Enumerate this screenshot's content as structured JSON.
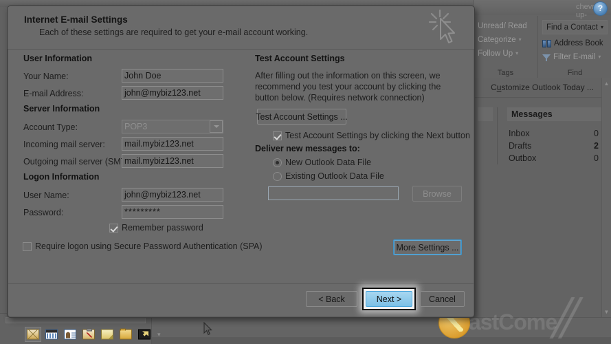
{
  "background": {
    "ribbon": {
      "help_icon": "?",
      "collapse_icon": "chevron-up-icon",
      "groups": [
        {
          "name": "Tags",
          "label": "Tags",
          "commands": [
            {
              "label": "Unread/ Read",
              "caret": ""
            },
            {
              "label": "Categorize",
              "caret": "▾"
            },
            {
              "label": "Follow Up",
              "caret": "▾"
            }
          ]
        },
        {
          "name": "Find",
          "label": "Find",
          "find_box": {
            "label": "Find a Contact",
            "caret": "▾"
          },
          "commands": [
            {
              "label": "Address Book",
              "caret": ""
            },
            {
              "label": "Filter E-mail",
              "caret": "▾"
            }
          ]
        }
      ]
    },
    "today_pane": {
      "customize_prefix": "C",
      "customize_underlined": "u",
      "customize_suffix": "stomize Outlook Today ...",
      "messages_title": "Messages",
      "messages": [
        {
          "label": "Inbox",
          "value": "0",
          "bold": false
        },
        {
          "label": "Drafts",
          "value": "2",
          "bold": true
        },
        {
          "label": "Outbox",
          "value": "0",
          "bold": false
        }
      ]
    },
    "nav_pane": {
      "icons": [
        {
          "name": "mail-icon",
          "selected": true
        },
        {
          "name": "calendar-icon",
          "selected": false
        },
        {
          "name": "contacts-icon",
          "selected": false
        },
        {
          "name": "tasks-icon",
          "selected": false
        },
        {
          "name": "notes-icon",
          "selected": false
        },
        {
          "name": "folder-list-icon",
          "selected": false
        },
        {
          "name": "shortcuts-icon",
          "selected": false
        }
      ],
      "overflow_caret": "▾"
    },
    "watermark": {
      "text": "astCome"
    }
  },
  "dialog": {
    "title": "Internet E-mail Settings",
    "subtitle": "Each of these settings are required to get your e-mail account working.",
    "wizard_icon": "wand-cursor-icon",
    "user_information": {
      "heading": "User Information",
      "fields": [
        {
          "label": "Your Name:",
          "value": "John Doe"
        },
        {
          "label": "E-mail Address:",
          "value": "john@mybiz123.net"
        }
      ]
    },
    "server_information": {
      "heading": "Server Information",
      "account_type": {
        "label": "Account Type:",
        "value": "POP3",
        "disabled": true
      },
      "fields": [
        {
          "label": "Incoming mail server:",
          "value": "mail.mybiz123.net"
        },
        {
          "label": "Outgoing mail server (SMTP):",
          "value": "mail.mybiz123.net"
        }
      ]
    },
    "logon_information": {
      "heading": "Logon Information",
      "fields": [
        {
          "label": "User Name:",
          "value": "john@mybiz123.net"
        },
        {
          "label": "Password:",
          "value": "*********"
        }
      ],
      "remember_password": {
        "label": "Remember password",
        "checked": true
      },
      "spa": {
        "label": "Require logon using Secure Password Authentication (SPA)",
        "checked": false
      }
    },
    "test_account": {
      "heading": "Test Account Settings",
      "description": "After filling out the information on this screen, we recommend you test your account by clicking the button below. (Requires network connection)",
      "test_button": "Test Account Settings ...",
      "auto_test": {
        "label": "Test Account Settings by clicking the Next button",
        "checked": true
      }
    },
    "deliver": {
      "heading": "Deliver new messages to:",
      "options": [
        {
          "label": "New Outlook Data File",
          "selected": true
        },
        {
          "label": "Existing Outlook Data File",
          "selected": false
        }
      ],
      "path_value": "",
      "browse_button": "Browse"
    },
    "more_settings_button": "More Settings ...",
    "footer": {
      "back": "< Back",
      "next": "Next >",
      "cancel": "Cancel"
    }
  }
}
